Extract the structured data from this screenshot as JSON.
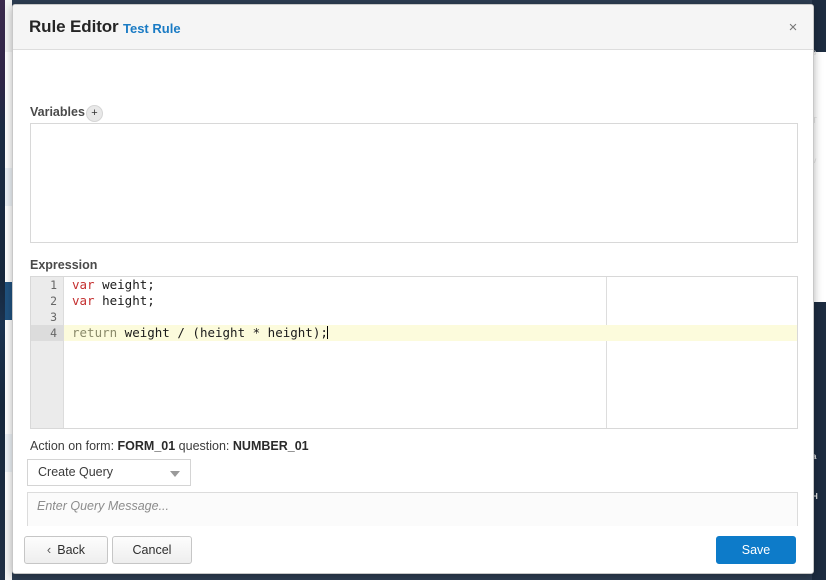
{
  "modal": {
    "title": "Rule Editor",
    "subtitle": "Test Rule",
    "close_label": "×"
  },
  "variables": {
    "label": "Variables",
    "add_label": "+",
    "items": []
  },
  "expression": {
    "label": "Expression",
    "lines": [
      {
        "number": "1",
        "text": "var weight;",
        "active": false
      },
      {
        "number": "2",
        "text": "var height;",
        "active": false
      },
      {
        "number": "3",
        "text": "",
        "active": false
      },
      {
        "number": "4",
        "text": "return weight / (height * height);",
        "active": true
      }
    ],
    "code_line_1_kw": "var",
    "code_line_1_rest": " weight;",
    "code_line_2_kw": "var",
    "code_line_2_rest": " height;",
    "code_line_4_kw": "return",
    "code_line_4_rest": " weight / (height * height);",
    "keyword_color": "#c42f2f",
    "return_color": "#8a8a6a",
    "active_line_color": "#fcfbdc"
  },
  "action": {
    "prefix": "Action on form: ",
    "form": "FORM_01",
    "middle": " question: ",
    "question": "NUMBER_01",
    "select_value": "Create Query",
    "select_options": [
      "Create Query"
    ],
    "query_placeholder": "Enter Query Message..."
  },
  "footer": {
    "back_label": "Back",
    "back_icon": "‹",
    "cancel_label": "Cancel",
    "save_label": "Save",
    "save_color": "#0d7bc9"
  }
}
